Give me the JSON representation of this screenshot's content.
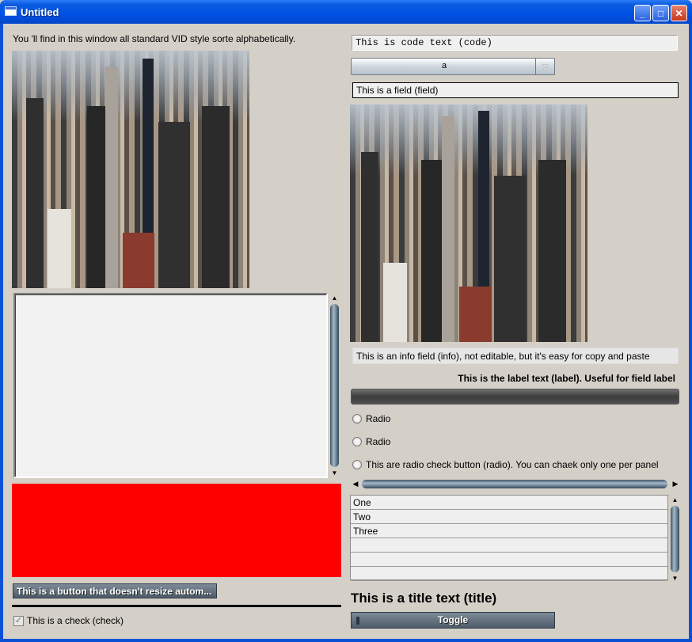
{
  "window": {
    "title": "Untitled",
    "controls": {
      "minimize": "_",
      "maximize": "□",
      "close": "✕"
    }
  },
  "left": {
    "intro_label": "You 'll find in this window all standard VID style sorte alphabetically.",
    "image_1_icon": "city-skyline-photo",
    "text_area_value": "",
    "button_label": "This is a button that doesn't resize autom...",
    "check": {
      "label": "This is a check (check)",
      "checked": true
    }
  },
  "right": {
    "code_text": "This is code text (code)",
    "dropdown_value": "a",
    "field_value": "This is a field (field)",
    "image_2_icon": "city-skyline-photo",
    "info_value": "This is an info field (info), not editable, but it's easy for copy and paste",
    "label_text": "This is the label text (label). Useful for field label",
    "radios": [
      {
        "label": "Radio"
      },
      {
        "label": "Radio"
      },
      {
        "label": "This are radio check button (radio). You can chaek only one per panel"
      }
    ],
    "list_items": [
      "One",
      "Two",
      "Three",
      "",
      "",
      ""
    ],
    "title_text": "This is a title text (title)",
    "toggle_label": "Toggle"
  },
  "colors": {
    "titlebar": "#0a5be0",
    "client_bg": "#d4d0c8",
    "red_box": "#ff0000"
  }
}
